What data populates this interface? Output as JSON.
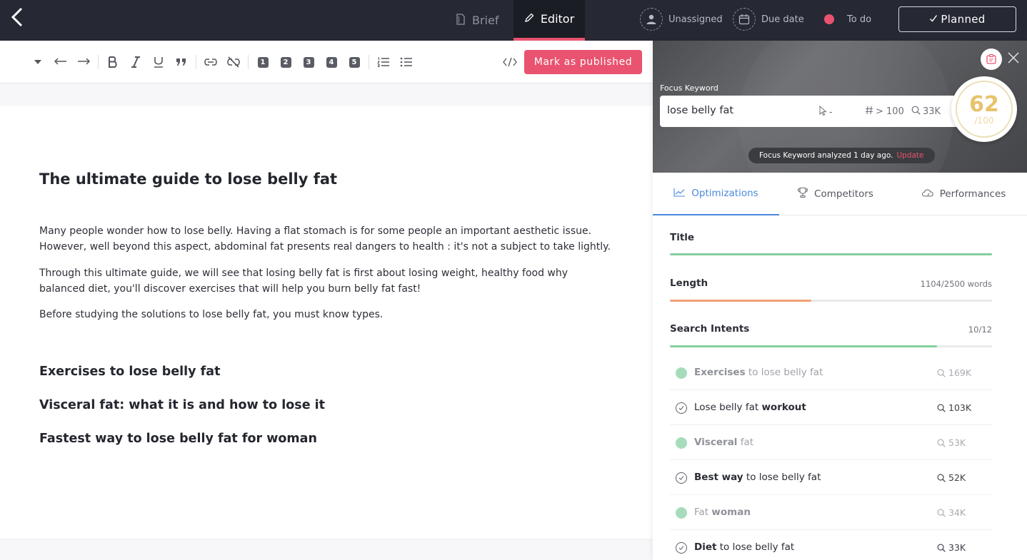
{
  "header": {
    "tabs": [
      {
        "label": "Brief",
        "icon": "document-icon"
      },
      {
        "label": "Editor",
        "icon": "pencil-icon",
        "active": true
      }
    ],
    "assignee": "Unassigned",
    "due_date": "Due date",
    "status": {
      "label": "To do",
      "color": "#e9536f"
    },
    "planned_label": "Planned"
  },
  "toolbar": {
    "heading_numbers": [
      "1",
      "2",
      "3",
      "4",
      "5"
    ],
    "publish_label": "Mark as published"
  },
  "document": {
    "title": "The ultimate guide to lose belly fat",
    "paragraphs": [
      "Many people wonder how to lose belly. Having a flat stomach is for some people an important aesthetic issue. However, well beyond this aspect, abdominal fat presents real dangers to health : it's not a subject to take lightly.",
      "Through this ultimate guide, we will see that losing belly fat is first about losing weight, healthy food why balanced diet, you'll discover exercises that will help you burn belly fat fast!",
      "Before studying the solutions to lose belly fat, you must know types."
    ],
    "subheadings": [
      "Exercises to lose belly fat",
      "Visceral fat: what it is and how to lose it",
      "Fastest way to lose belly fat for woman"
    ]
  },
  "panel": {
    "focus_label": "Focus Keyword",
    "keyword": "lose belly fat",
    "clicks": "-",
    "rank": "> 100",
    "volume": "33K",
    "score": "62",
    "score_max": "/100",
    "analyzed_text": "Focus Keyword analyzed 1 day ago.",
    "update_label": "Update",
    "tabs": [
      "Optimizations",
      "Competitors",
      "Performances"
    ],
    "sections": {
      "title": {
        "label": "Title",
        "progress": 1.0,
        "color": "#82cf9c"
      },
      "length": {
        "label": "Length",
        "count": "1104/2500 words",
        "progress": 0.44,
        "color": "#f0a276"
      },
      "intents": {
        "label": "Search Intents",
        "count": "10/12",
        "progress": 0.83,
        "color": "#82cf9c"
      }
    },
    "intents": [
      {
        "pre": "",
        "bold": "Exercises",
        "post": " to lose belly fat",
        "volume": "169K",
        "done": true
      },
      {
        "pre": "Lose belly fat ",
        "bold": "workout",
        "post": "",
        "volume": "103K",
        "done": false
      },
      {
        "pre": "",
        "bold": "Visceral",
        "post": " fat",
        "volume": "53K",
        "done": true
      },
      {
        "pre": "",
        "bold": "Best way",
        "post": " to lose belly fat",
        "volume": "52K",
        "done": false
      },
      {
        "pre": "Fat ",
        "bold": "woman",
        "post": "",
        "volume": "34K",
        "done": true
      },
      {
        "pre": "",
        "bold": "Diet",
        "post": " to lose belly fat",
        "volume": "33K",
        "done": false
      }
    ]
  }
}
